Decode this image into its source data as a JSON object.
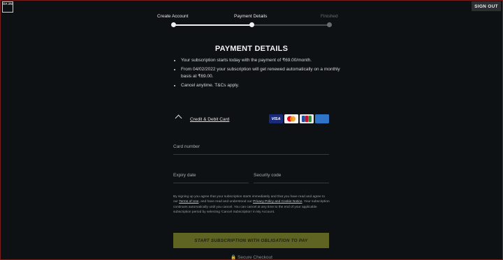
{
  "brand": {
    "logo_text": "DA ZN"
  },
  "header": {
    "signout_label": "SIGN OUT"
  },
  "steps": [
    {
      "label": "Create Account",
      "state": "done"
    },
    {
      "label": "Payment Details",
      "state": "current"
    },
    {
      "label": "Finished",
      "state": "todo"
    }
  ],
  "page": {
    "title": "PAYMENT DETAILS"
  },
  "bullets": [
    "Your subscription starts today with the payment of ₹69.00/month.",
    "From 04/02/2022 your subscription will get renewed automatically on a monthly basis at ₹69.00.",
    "Cancel anytime. T&Cs apply."
  ],
  "payment": {
    "method_label": "Credit & Debit Card",
    "cards": [
      "VISA",
      "MASTERCARD",
      "JCB",
      "AMEX"
    ]
  },
  "form": {
    "card_number_placeholder": "Card number",
    "expiry_placeholder": "Expiry date",
    "security_placeholder": "Security code"
  },
  "legal": {
    "part1": "By signing up you agree that your subscription starts immediately and that you have read and agree to our ",
    "terms": "Terms of Use",
    "part2": ", and have read and understood our ",
    "privacy": "Privacy Policy and Cookie Notice",
    "part3": ". Your subscription continues automatically until you cancel. You can cancel at any time to the end of your applicable subscription period by selecting 'Cancel Subscription' in My Account."
  },
  "cta": {
    "label": "START SUBSCRIPTION WITH OBLIGATION TO PAY"
  },
  "footer": {
    "secure_label": "Secure Checkout"
  },
  "colors": {
    "background": "#0d1113",
    "cta": "#5f6423",
    "border": "#7a1d1d"
  }
}
